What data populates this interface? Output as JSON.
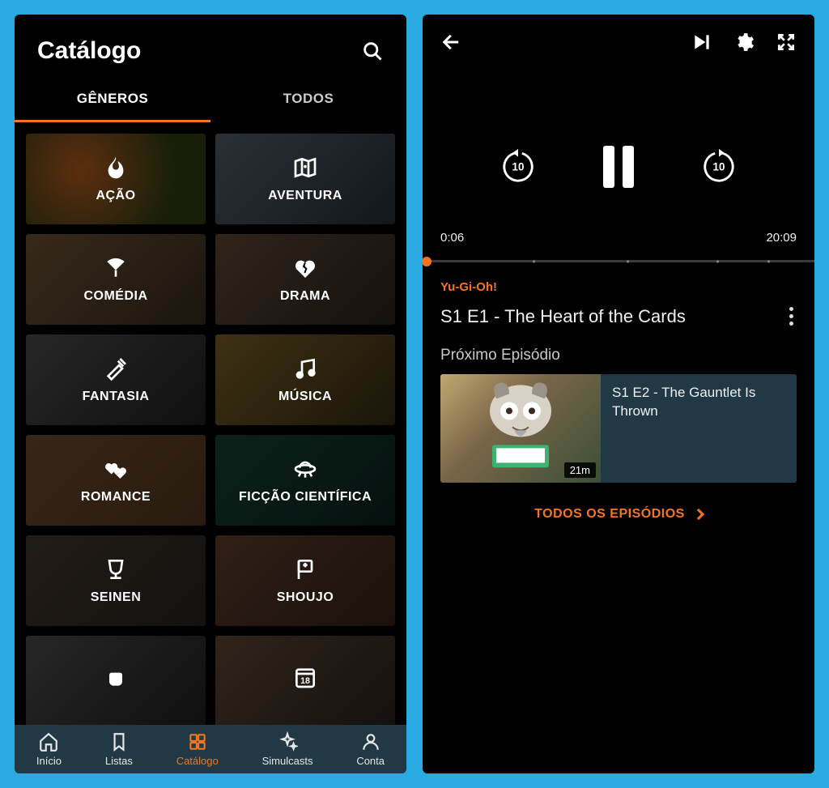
{
  "colors": {
    "accent": "#f47521",
    "bg": "#000000",
    "navbg": "#213944"
  },
  "left": {
    "title": "Catálogo",
    "tabs": {
      "genres": "GÊNEROS",
      "all": "TODOS",
      "active": "genres"
    },
    "genres": [
      {
        "label": "AÇÃO",
        "icon": "flame"
      },
      {
        "label": "AVENTURA",
        "icon": "map"
      },
      {
        "label": "COMÉDIA",
        "icon": "fan"
      },
      {
        "label": "DRAMA",
        "icon": "broken-heart"
      },
      {
        "label": "FANTASIA",
        "icon": "sword"
      },
      {
        "label": "MÚSICA",
        "icon": "music"
      },
      {
        "label": "ROMANCE",
        "icon": "hearts"
      },
      {
        "label": "FICÇÃO CIENTÍFICA",
        "icon": "ufo"
      },
      {
        "label": "SEINEN",
        "icon": "cup"
      },
      {
        "label": "SHOUJO",
        "icon": "flag"
      }
    ],
    "nav": [
      {
        "label": "Início",
        "icon": "home"
      },
      {
        "label": "Listas",
        "icon": "bookmark"
      },
      {
        "label": "Catálogo",
        "icon": "grid",
        "active": true
      },
      {
        "label": "Simulcasts",
        "icon": "sparkle"
      },
      {
        "label": "Conta",
        "icon": "account"
      }
    ]
  },
  "right": {
    "player": {
      "current_time": "0:06",
      "total_time": "20:09",
      "rewind_seconds": "10",
      "forward_seconds": "10"
    },
    "series": "Yu-Gi-Oh!",
    "episode_title": "S1 E1 - The Heart of the Cards",
    "next_label": "Próximo Episódio",
    "next_episode": {
      "title": "S1 E2 - The Gauntlet Is Thrown",
      "duration": "21m"
    },
    "all_episodes_label": "TODOS OS EPISÓDIOS"
  }
}
